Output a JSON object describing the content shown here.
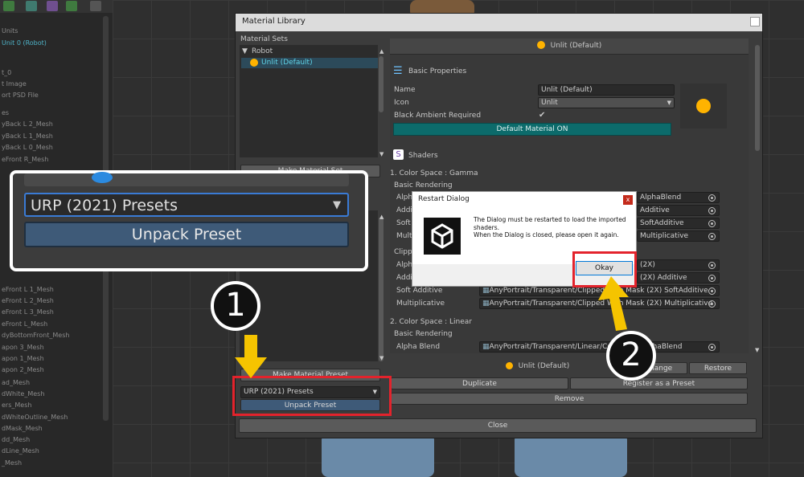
{
  "background": {
    "hierarchy_items": [
      "Units",
      "Unit 0 (Robot)",
      "t_0",
      "t Image",
      "ort PSD File",
      "es",
      "yBack L 2_Mesh",
      "yBack L 1_Mesh",
      "yBack L 0_Mesh",
      "eFront R_Mesh",
      "eFront L 1_Mesh",
      "eFront L 2_Mesh",
      "eFront L 3_Mesh",
      "eFront L_Mesh",
      "dyBottomFront_Mesh",
      "apon 3_Mesh",
      "apon 1_Mesh",
      "apon 2_Mesh",
      "ad_Mesh",
      "dWhite_Mesh",
      "ers_Mesh",
      "dWhiteOutline_Mesh",
      "dMask_Mesh",
      "dd_Mesh",
      "dLine_Mesh",
      "_Mesh"
    ]
  },
  "window": {
    "title": "Material Library",
    "material_sets_label": "Material Sets",
    "tree_root": "Robot",
    "tree_child": "Unlit (Default)",
    "make_material_set_btn": "Make Material Set",
    "make_material_preset_btn": "Make Material Preset",
    "preset_dropdown": "URP (2021) Presets",
    "unpack_preset_btn": "Unpack Preset",
    "header_material": "Unlit (Default)",
    "basic_properties": "Basic Properties",
    "name_label": "Name",
    "name_value": "Unlit (Default)",
    "icon_label": "Icon",
    "icon_value": "Unlit",
    "black_ambient_label": "Black Ambient Required",
    "default_material_bar": "Default Material ON",
    "shaders_label": "Shaders",
    "color_space_gamma": "1. Color Space : Gamma",
    "basic_rendering": "Basic Rendering",
    "clipped_rendering": "Clipped",
    "color_space_linear": "2. Color Space : Linear",
    "basic_rendering_2": "Basic Rendering",
    "row_labels_partial": [
      "Alpha",
      "Addit",
      "Soft",
      "Multip",
      "Clippe",
      "Alpha",
      "Addit"
    ],
    "right_shader_values": [
      "AlphaBlend",
      "Additive",
      "SoftAdditive",
      "Multiplicative"
    ],
    "clipped_right_values": [
      "(2X)",
      "(2X) Additive"
    ],
    "soft_additive_label": "Soft Additive",
    "soft_additive_value": "AnyPortrait/Transparent/Clipped With Mask (2X) SoftAdditive",
    "multiplicative_label": "Multiplicative",
    "multiplicative_value": "AnyPortrait/Transparent/Clipped With Mask (2X) Multiplicative",
    "alpha_blend_label": "Alpha Blend",
    "alpha_blend_value": "AnyPortrait/Transparent/Linear/Color (2X) AlphaBlend",
    "bottom_material": "Unlit (Default)",
    "change_btn": "Change",
    "restore_btn": "Restore",
    "duplicate_btn": "Duplicate",
    "register_preset_btn": "Register as a Preset",
    "remove_btn": "Remove",
    "close_btn": "Close"
  },
  "zoom": {
    "dropdown": "URP (2021) Presets",
    "unpack_btn": "Unpack Preset"
  },
  "dialog": {
    "title": "Restart Dialog",
    "close": "x",
    "message_1": "The Dialog must be restarted to load the imported shaders.",
    "message_2": "When the Dialog is closed, please open it again.",
    "okay_btn": "Okay"
  },
  "callouts": {
    "step1": "1",
    "step2": "2"
  },
  "colors": {
    "accent_teal": "#0c6b6b",
    "highlight_red": "#e3232c",
    "arrow_yellow": "#f5c400",
    "material_dot": "#ffb300"
  }
}
